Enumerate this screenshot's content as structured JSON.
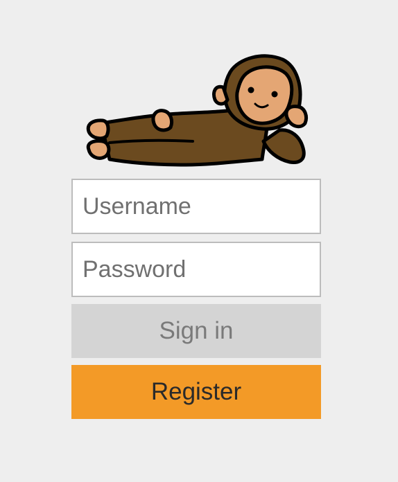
{
  "login": {
    "mascot_icon": "reclining-monkey-icon",
    "username_placeholder": "Username",
    "username_value": "",
    "password_placeholder": "Password",
    "password_value": "",
    "signin_label": "Sign in",
    "register_label": "Register"
  },
  "colors": {
    "background": "#eeeeee",
    "field_border": "#bcbcbc",
    "signin_bg": "#d4d4d4",
    "signin_text": "#7a7a7a",
    "register_bg": "#f39a27",
    "register_text": "#2a2a2a",
    "monkey_fur": "#6b4a1f",
    "monkey_skin": "#e4a674"
  }
}
